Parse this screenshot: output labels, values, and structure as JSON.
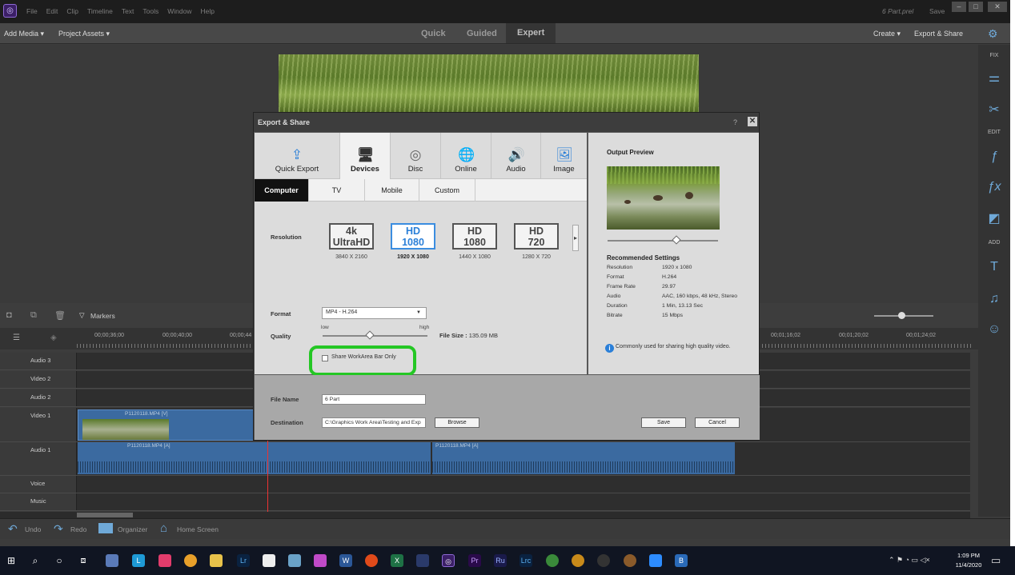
{
  "menu": {
    "items": [
      "File",
      "Edit",
      "Clip",
      "Timeline",
      "Text",
      "Tools",
      "Window",
      "Help"
    ],
    "project_name": "6 Part.prel",
    "save_label": "Save"
  },
  "modebar": {
    "add_media": "Add Media ▾",
    "project_assets": "Project Assets ▾",
    "modes": [
      "Quick",
      "Guided",
      "Expert"
    ],
    "create": "Create ▾",
    "export_share": "Export & Share"
  },
  "right_panel": {
    "fix": "FIX",
    "edit": "EDIT",
    "add": "ADD"
  },
  "timeline": {
    "markers_label": "Markers",
    "timecodes": [
      "00;00;36;00",
      "00;00;40;00",
      "00;00;44",
      "00;01;16;02",
      "00;01;20;02",
      "00;01;24;02"
    ],
    "tracks": [
      "Audio 3",
      "Video 2",
      "Audio 2",
      "Video 1",
      "Audio 1",
      "Voice",
      "Music"
    ],
    "clip_video": "P1120118.MP4 [V]",
    "clip_audio": "P1120118.MP4 [A]",
    "clip_audio2": "P1120118.MP4 [A]"
  },
  "bottom": {
    "undo": "Undo",
    "redo": "Redo",
    "organizer": "Organizer",
    "home": "Home Screen"
  },
  "taskbar": {
    "time": "1:09 PM",
    "date": "11/4/2020"
  },
  "dialog": {
    "title": "Export & Share",
    "categories": [
      "Quick Export",
      "Devices",
      "Disc",
      "Online",
      "Audio",
      "Image"
    ],
    "subtabs": [
      "Computer",
      "TV",
      "Mobile",
      "Custom"
    ],
    "resolution_label": "Resolution",
    "resolutions": [
      {
        "line1": "4k",
        "line2": "UltraHD",
        "dims": "3840 X 2160"
      },
      {
        "line1": "HD",
        "line2": "1080",
        "dims": "1920 X 1080"
      },
      {
        "line1": "HD",
        "line2": "1080",
        "dims": "1440 X 1080"
      },
      {
        "line1": "HD",
        "line2": "720",
        "dims": "1280 X 720"
      }
    ],
    "format_label": "Format",
    "format_value": "MP4 - H.264",
    "quality_label": "Quality",
    "quality_low": "low",
    "quality_high": "high",
    "quality_level": 0.45,
    "file_size_label": "File Size :",
    "file_size_value": "135.09 MB",
    "share_workarea": "Share WorkArea Bar Only",
    "output_preview": "Output Preview",
    "recommended_title": "Recommended Settings",
    "settings": [
      {
        "k": "Resolution",
        "v": "1920 x 1080"
      },
      {
        "k": "Format",
        "v": "H.264"
      },
      {
        "k": "Frame Rate",
        "v": "29.97"
      },
      {
        "k": "Audio",
        "v": "AAC, 160 kbps, 48 kHz, Stereo"
      },
      {
        "k": "Duration",
        "v": "1 Min, 13.13 Sec"
      },
      {
        "k": "Bitrate",
        "v": "15 Mbps"
      }
    ],
    "info": "Commonly used for sharing high quality video.",
    "file_name_label": "File Name",
    "file_name_value": "6 Part",
    "destination_label": "Destination",
    "destination_value": "C:\\Graphics Work Area\\Testing and Exp",
    "browse": "Browse",
    "save": "Save",
    "cancel": "Cancel"
  }
}
